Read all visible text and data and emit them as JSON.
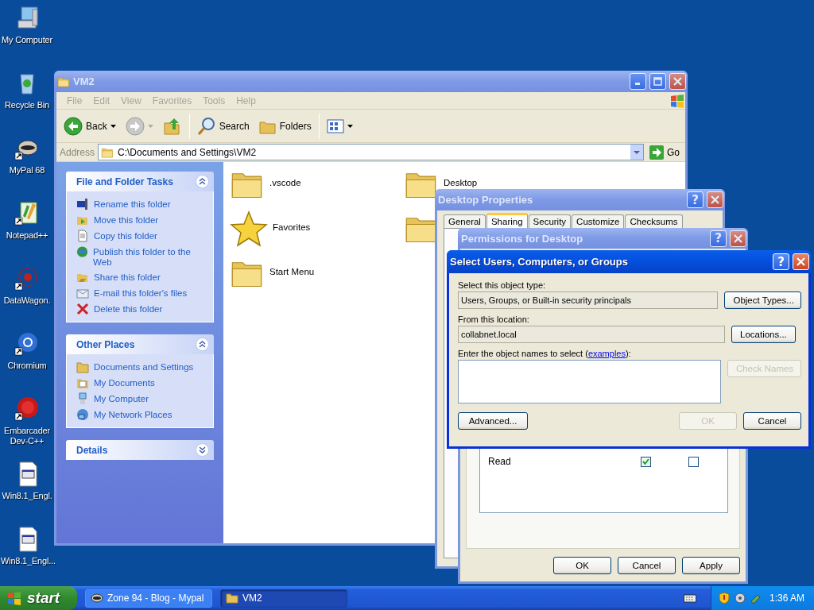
{
  "desktop_icons": [
    {
      "label": "My Computer"
    },
    {
      "label": "Recycle Bin"
    },
    {
      "label": "MyPal 68"
    },
    {
      "label": "Notepad++"
    },
    {
      "label": "DataWagon."
    },
    {
      "label": "Chromium"
    },
    {
      "label": "Embarcader Dev-C++"
    },
    {
      "label": "Win8.1_Engl."
    },
    {
      "label": "Win8.1_Engl..."
    }
  ],
  "explorer": {
    "title": "VM2",
    "active": false,
    "menu": [
      "File",
      "Edit",
      "View",
      "Favorites",
      "Tools",
      "Help"
    ],
    "toolbar": {
      "back": "Back",
      "search": "Search",
      "folders": "Folders"
    },
    "address": {
      "label": "Address",
      "path": "C:\\Documents and Settings\\VM2",
      "go": "Go"
    },
    "panels": [
      {
        "title": "File and Folder Tasks",
        "expanded": true,
        "items": [
          {
            "label": "Rename this folder"
          },
          {
            "label": "Move this folder"
          },
          {
            "label": "Copy this folder"
          },
          {
            "label": "Publish this folder to the Web"
          },
          {
            "label": "Share this folder"
          },
          {
            "label": "E-mail this folder's files"
          },
          {
            "label": "Delete this folder"
          }
        ]
      },
      {
        "title": "Other Places",
        "expanded": true,
        "items": [
          {
            "label": "Documents and Settings"
          },
          {
            "label": "My Documents"
          },
          {
            "label": "My Computer"
          },
          {
            "label": "My Network Places"
          }
        ]
      },
      {
        "title": "Details",
        "expanded": false
      }
    ],
    "files": [
      {
        "name": ".vscode",
        "kind": "folder"
      },
      {
        "name": "Favorites",
        "kind": "favorites"
      },
      {
        "name": "Start Menu",
        "kind": "folder"
      },
      {
        "name": "Desktop",
        "kind": "folder"
      },
      {
        "kind": "folder"
      }
    ]
  },
  "desktop_properties": {
    "title": "Desktop Properties",
    "active": false,
    "help": "?",
    "tabs": [
      {
        "label": "General",
        "selected": false
      },
      {
        "label": "Sharing",
        "selected": true
      },
      {
        "label": "Security",
        "selected": false
      },
      {
        "label": "Customize",
        "selected": false
      },
      {
        "label": "Checksums",
        "selected": false
      }
    ]
  },
  "permissions": {
    "title": "Permissions for Desktop",
    "active": false,
    "help": "?",
    "rows": [
      {
        "label": "Read",
        "allow": true,
        "deny": false
      }
    ],
    "buttons": [
      "OK",
      "Cancel",
      "Apply"
    ]
  },
  "select_dialog": {
    "title": "Select Users, Computers, or Groups",
    "active": true,
    "help": "?",
    "object_type_label": "Select this object type:",
    "object_type": "Users, Groups, or Built-in security principals",
    "object_types_button": "Object Types...",
    "location_label": "From this location:",
    "location": "collabnet.local",
    "locations_button": "Locations...",
    "names_prefix": "Enter the object names to select (",
    "names_link": "examples",
    "names_suffix": "):",
    "check_names": {
      "label": "Check Names",
      "disabled": true
    },
    "advanced": {
      "label": "Advanced...",
      "disabled": false
    },
    "ok": {
      "label": "OK",
      "disabled": true
    },
    "cancel": {
      "label": "Cancel",
      "disabled": false
    }
  },
  "taskbar": {
    "start": "start",
    "tasks": [
      {
        "label": "Zone 94 - Blog - Mypal",
        "selected": false
      },
      {
        "label": "VM2",
        "selected": true
      }
    ],
    "clock": "1:36 AM"
  }
}
